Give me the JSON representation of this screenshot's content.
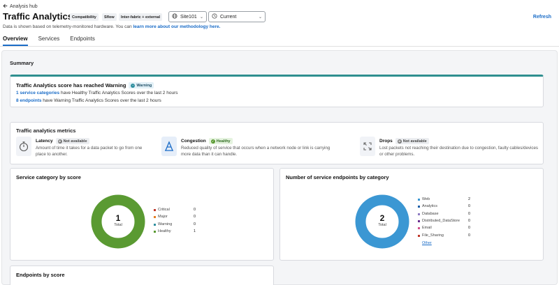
{
  "header": {
    "back_label": "Analysis hub",
    "title": "Traffic Analytics",
    "tags": [
      "Compatibility",
      "Sflow",
      "Inter-fabric + external"
    ],
    "site_select": "Site101",
    "time_select": "Current",
    "refresh_label": "Refresh",
    "subtitle_text": "Data is shown based on telemetry-monitored hardware. You can ",
    "subtitle_link": "learn more about our methodology here."
  },
  "tabs": [
    {
      "label": "Overview",
      "active": true
    },
    {
      "label": "Services",
      "active": false
    },
    {
      "label": "Endpoints",
      "active": false
    }
  ],
  "summary": {
    "heading": "Summary",
    "alert_title": "Traffic Analytics score has reached Warning",
    "alert_badge": "Warning",
    "line1_link": "1 service categories",
    "line1_text": " have Healthy Traffic Analytics Scores over the last 2 hours",
    "line2_link": "8 endpoints",
    "line2_text": " have Warning Traffic Analytics Scores over the last 2 hours"
  },
  "metrics": {
    "heading": "Traffic analytics metrics",
    "items": [
      {
        "name": "Latency",
        "badge": "Not available",
        "status": "na",
        "icon": "stopwatch-icon",
        "desc": "Amount of time it takes for a data packet to go from one place to another."
      },
      {
        "name": "Congestion",
        "badge": "Healthy",
        "status": "ok",
        "icon": "congestion-icon",
        "desc": "Reduced quality of service that occurs when a network node or link is carrying more data than it can handle."
      },
      {
        "name": "Drops",
        "badge": "Not available",
        "status": "na",
        "icon": "drops-icon",
        "desc": "Lost packets not reaching their destination due to congestion, faulty cables/devices or other problems."
      }
    ]
  },
  "service_category": {
    "title": "Service category by score",
    "total": "1",
    "total_label": "Total",
    "legend": [
      {
        "label": "Critical",
        "value": "0",
        "color": "#c0392b"
      },
      {
        "label": "Major",
        "value": "0",
        "color": "#e67e22"
      },
      {
        "label": "Warning",
        "value": "0",
        "color": "#2f8f9f"
      },
      {
        "label": "Healthy",
        "value": "1",
        "color": "#5a9a32"
      }
    ]
  },
  "endpoints_category": {
    "title": "Number of service endpoints by category",
    "total": "2",
    "total_label": "Total",
    "legend": [
      {
        "label": "Web",
        "value": "2",
        "color": "#3b97d3"
      },
      {
        "label": "Analytics",
        "value": "0",
        "color": "#1f5fa8"
      },
      {
        "label": "Database",
        "value": "0",
        "color": "#8e7cc3"
      },
      {
        "label": "Distributed_DataStore",
        "value": "0",
        "color": "#6a2f8f"
      },
      {
        "label": "Email",
        "value": "0",
        "color": "#d0508a"
      },
      {
        "label": "File_Sharing",
        "value": "0",
        "color": "#c0392b"
      }
    ],
    "more_label": "Other"
  },
  "endpoints_by_score": {
    "title": "Endpoints by score"
  },
  "colors": {
    "accent": "#1a6cc7",
    "healthy": "#5a9a32",
    "web": "#3b97d3",
    "alert_bar": "#2f8f8f"
  }
}
